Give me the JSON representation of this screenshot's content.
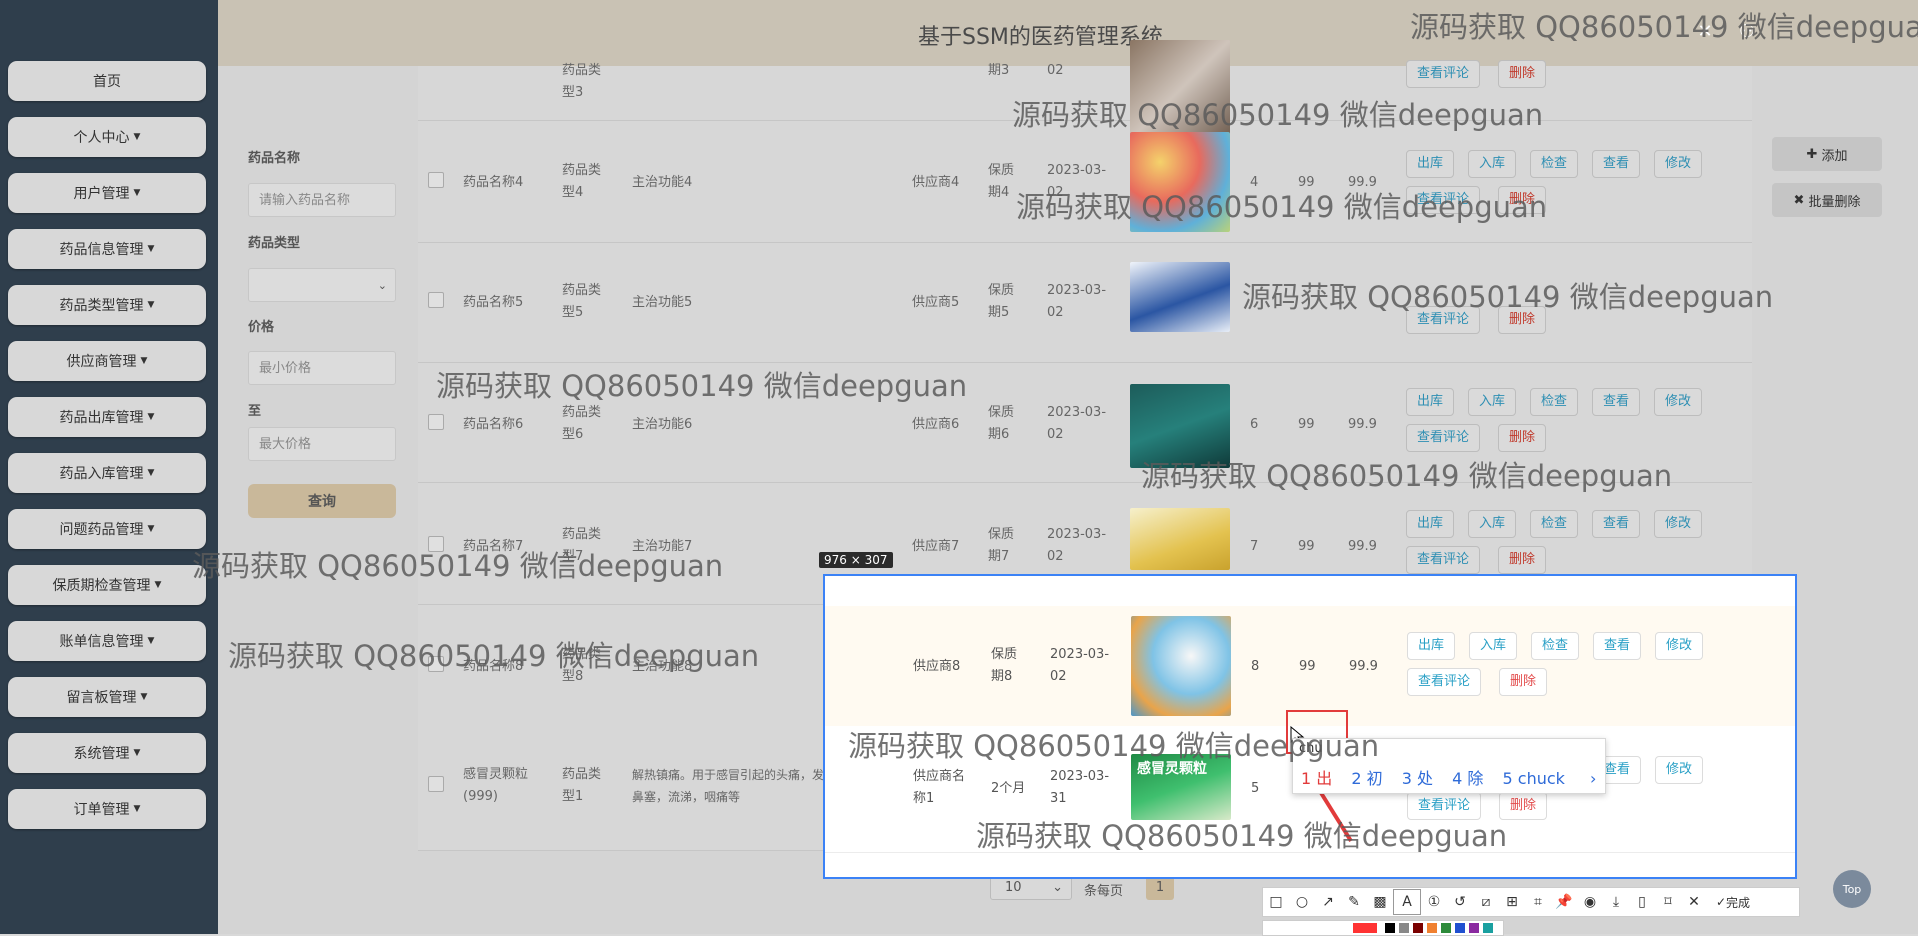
{
  "header": {
    "title": "基于SSM的医药管理系统"
  },
  "sidebar": {
    "items": [
      "首页",
      "个人中心",
      "用户管理",
      "药品信息管理",
      "药品类型管理",
      "供应商管理",
      "药品出库管理",
      "药品入库管理",
      "问题药品管理",
      "保质期检查管理",
      "账单信息管理",
      "留言板管理",
      "系统管理",
      "订单管理"
    ]
  },
  "search": {
    "name_label": "药品名称",
    "name_placeholder": "请输入药品名称",
    "type_label": "药品类型",
    "price_label": "价格",
    "min_placeholder": "最小价格",
    "to_label": "至",
    "max_placeholder": "最大价格",
    "query_label": "查询"
  },
  "actions": {
    "add": "添加",
    "batch_delete": "批量删除"
  },
  "rows": [
    {
      "name": "",
      "type": "药品类\n型3",
      "func": "",
      "supplier": "",
      "period": "期3",
      "date": "02",
      "stock": "",
      "qty": "",
      "price": ""
    },
    {
      "name": "药品名称4",
      "type": "药品类\n型4",
      "func": "主治功能4",
      "supplier": "供应商4",
      "period": "保质\n期4",
      "date": "2023-03-\n02",
      "stock": "4",
      "qty": "99",
      "price": "99.9"
    },
    {
      "name": "药品名称5",
      "type": "药品类\n型5",
      "func": "主治功能5",
      "supplier": "供应商5",
      "period": "保质\n期5",
      "date": "2023-03-\n02",
      "stock": "",
      "qty": "",
      "price": ""
    },
    {
      "name": "药品名称6",
      "type": "药品类\n型6",
      "func": "主治功能6",
      "supplier": "供应商6",
      "period": "保质\n期6",
      "date": "2023-03-\n02",
      "stock": "6",
      "qty": "99",
      "price": "99.9"
    },
    {
      "name": "药品名称7",
      "type": "药品类\n型7",
      "func": "主治功能7",
      "supplier": "供应商7",
      "period": "保质\n期7",
      "date": "2023-03-\n02",
      "stock": "7",
      "qty": "99",
      "price": "99.9"
    }
  ],
  "row8": {
    "name": "药品名称8",
    "type": "药品类\n型8",
    "func": "主治功能8",
    "supplier": "供应商8",
    "period": "保质\n期8",
    "date": "2023-03-\n02",
    "stock": "8",
    "qty": "99",
    "price": "99.9"
  },
  "row9": {
    "name": "感冒灵颗粒\n(999)",
    "type": "药品类\n型1",
    "func": "解热镇痛。用于感冒引起的头痛，发热，\n鼻塞，流涕，咽痛等",
    "supplier": "供应商名\n称1",
    "period": "2个月",
    "date": "2023-03-\n31",
    "stock": "5",
    "package_text": "感冒灵颗粒"
  },
  "ops": {
    "out": "出库",
    "in": "入库",
    "check": "检查",
    "view": "查看",
    "edit": "修改",
    "comments": "查看评论",
    "delete": "删除"
  },
  "overlay": {
    "dimensions": "976 × 307"
  },
  "ime": {
    "input": "chu",
    "candidates": [
      "1 出",
      "2 初",
      "3 处",
      "4 除",
      "5 chuck"
    ]
  },
  "toolbar": {
    "done": "完成"
  },
  "pager": {
    "page_size": "10",
    "per_page": "条每页",
    "current": "1"
  },
  "watermark": "源码获取 QQ86050149 微信deepguan",
  "top_label": "Top",
  "colors": {
    "sidebar": "#2f3e4c",
    "header": "#c9c2b4",
    "accent": "#2aa0c6",
    "danger": "#e34b4b",
    "selection": "#3b82f6"
  }
}
